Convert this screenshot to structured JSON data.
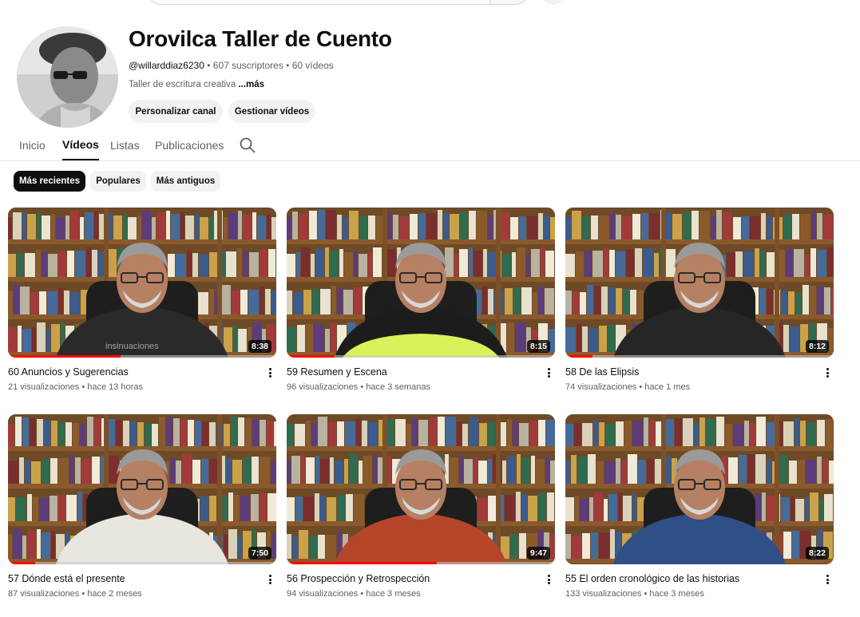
{
  "channel": {
    "title": "Orovilca Taller de Cuento",
    "handle": "@willarddiaz6230",
    "subscribers": "607 suscriptores",
    "video_count": "60 vídeos",
    "separator": " • ",
    "description": "Taller de escritura creativa",
    "more_label": "...más",
    "customize_label": "Personalizar canal",
    "manage_label": "Gestionar vídeos"
  },
  "tabs": [
    {
      "label": "Inicio",
      "active": false
    },
    {
      "label": "Vídeos",
      "active": true
    },
    {
      "label": "Listas",
      "active": false
    },
    {
      "label": "Publicaciones",
      "active": false
    }
  ],
  "chips": [
    {
      "label": "Más recientes",
      "active": true
    },
    {
      "label": "Populares",
      "active": false
    },
    {
      "label": "Más antiguos",
      "active": false
    }
  ],
  "videos": [
    {
      "title": "60 Anuncios y Sugerencias",
      "views": "21 visualizaciones",
      "age": "hace 13 horas",
      "duration": "8:38",
      "watched": 0.42,
      "shirt": "#2a2a2a",
      "watermark": "insinuaciones"
    },
    {
      "title": "59 Resumen y Escena",
      "views": "96 visualizaciones",
      "age": "hace 3 semanas",
      "duration": "8:15",
      "watched": 0.18,
      "shirt": "#1c1c1c",
      "accent": "#d8f25a"
    },
    {
      "title": "58 De las Elipsis",
      "views": "74 visualizaciones",
      "age": "hace 1 mes",
      "duration": "8:12",
      "watched": 0.1,
      "shirt": "#262626"
    },
    {
      "title": "57 Dónde está el presente",
      "views": "87 visualizaciones",
      "age": "hace 2 meses",
      "duration": "7:50",
      "watched": 0.1,
      "shirt": "#e8e6df"
    },
    {
      "title": "56 Prospección y Retrospección",
      "views": "94 visualizaciones",
      "age": "hace 3 meses",
      "duration": "9:47",
      "watched": 0.56,
      "shirt": "#b5462a"
    },
    {
      "title": "55 El orden cronológico de las historias",
      "views": "133 visualizaciones",
      "age": "hace 3 meses",
      "duration": "8:22",
      "watched": 0.0,
      "shirt": "#2f4f86"
    }
  ],
  "icons": {
    "search": "search-icon",
    "kebab": "more-vert-icon"
  }
}
